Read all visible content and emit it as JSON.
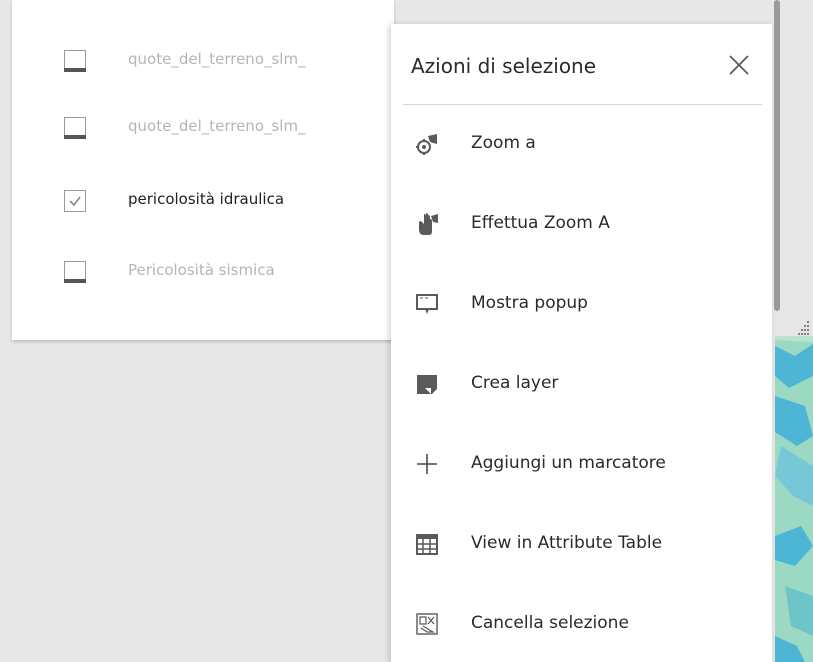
{
  "layers": [
    {
      "label": "quote_del_terreno_slm_",
      "checked": false,
      "enabled": false
    },
    {
      "label": "quote_del_terreno_slm_",
      "checked": false,
      "enabled": false
    },
    {
      "label": "pericolosità idraulica",
      "checked": true,
      "enabled": true
    },
    {
      "label": "Pericolosità sismica",
      "checked": false,
      "enabled": false
    }
  ],
  "actions_panel": {
    "title": "Azioni di selezione",
    "close_icon": "close-icon",
    "items": [
      {
        "label": "Zoom a",
        "icon": "zoom-to-icon"
      },
      {
        "label": "Effettua Zoom A",
        "icon": "pan-hand-icon"
      },
      {
        "label": "Mostra popup",
        "icon": "popup-icon"
      },
      {
        "label": "Crea layer",
        "icon": "create-layer-icon"
      },
      {
        "label": "Aggiungi un marcatore",
        "icon": "plus-icon"
      },
      {
        "label": "View in Attribute Table",
        "icon": "table-icon"
      },
      {
        "label": "Cancella selezione",
        "icon": "clear-selection-icon"
      }
    ]
  },
  "colors": {
    "map_water": "#9bd9c2",
    "map_channel": "#4cb6d4",
    "text_disabled": "#b5b5b5",
    "text_active": "#1f1f1f"
  }
}
